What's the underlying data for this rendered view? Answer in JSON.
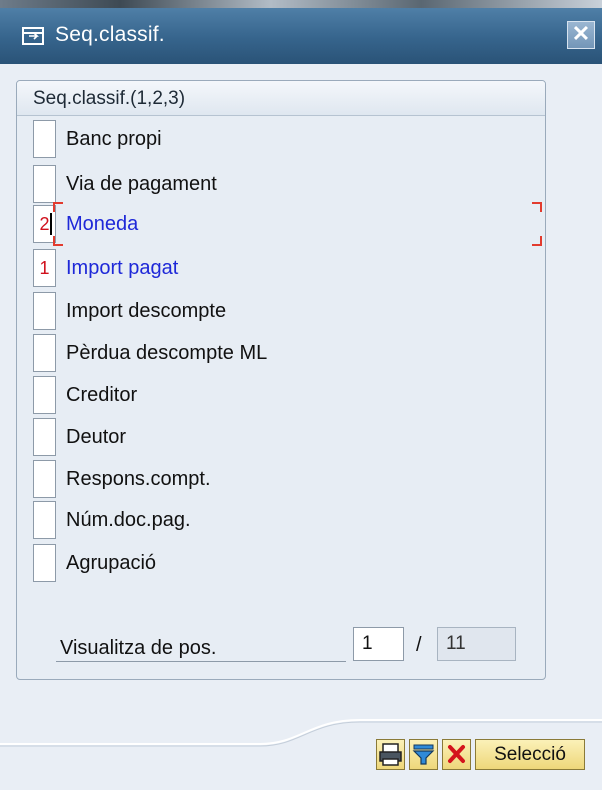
{
  "window": {
    "title": "Seq.classif.",
    "close_symbol": "✕",
    "title_icon": "dialog-window-icon"
  },
  "group": {
    "title": "Seq.classif.(1,2,3)"
  },
  "fields": [
    {
      "label": "Banc propi",
      "seq": ""
    },
    {
      "label": "Via de pagament",
      "seq": ""
    },
    {
      "label": "Moneda",
      "seq": "2"
    },
    {
      "label": "Import pagat",
      "seq": "1"
    },
    {
      "label": "Import descompte",
      "seq": ""
    },
    {
      "label": "Pèrdua descompte ML",
      "seq": ""
    },
    {
      "label": "Creditor",
      "seq": ""
    },
    {
      "label": "Deutor",
      "seq": ""
    },
    {
      "label": "Respons.compt.",
      "seq": ""
    },
    {
      "label": "Núm.doc.pag.",
      "seq": ""
    },
    {
      "label": "Agrupació",
      "seq": ""
    }
  ],
  "position": {
    "label": "Visualitza de pos.",
    "current": "1",
    "separator": "/",
    "total": "11"
  },
  "buttons": {
    "print_icon": "print-icon",
    "filter_icon": "filter-icon",
    "cancel_icon": "cancel-icon",
    "select_label": "Selecció"
  },
  "colors": {
    "title_bar": "#36648c",
    "selected_text": "#1e28d8",
    "sequence_number": "#d0101c",
    "button_bg": "#eed77a"
  }
}
